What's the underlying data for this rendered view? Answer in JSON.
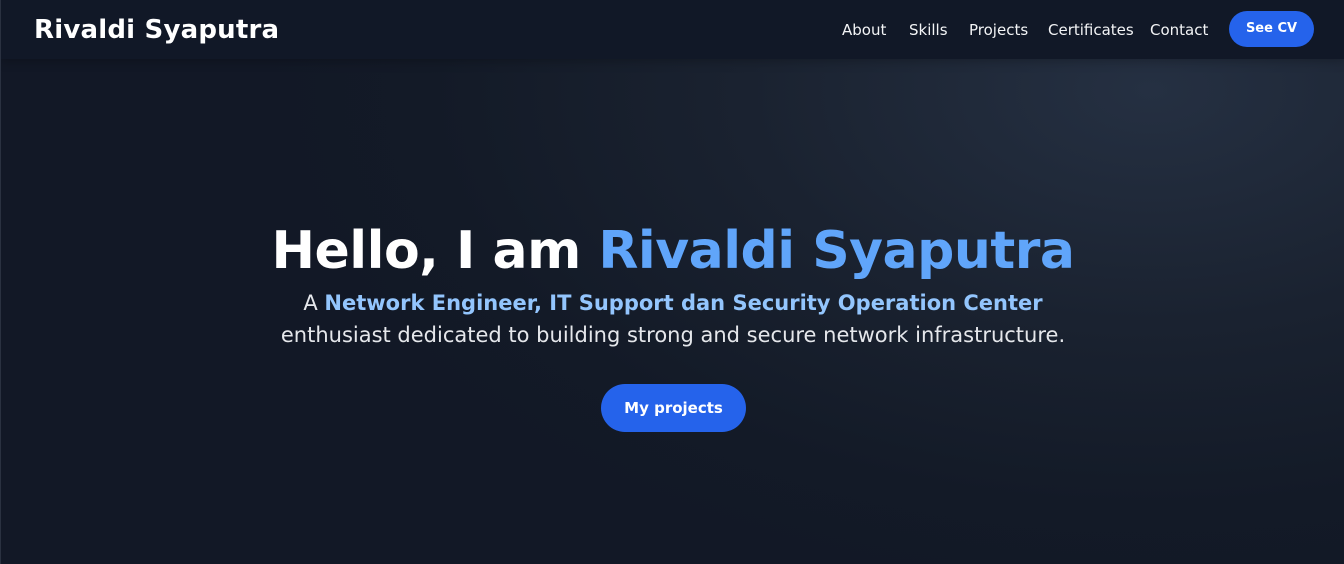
{
  "nav": {
    "brand": "Rivaldi Syaputra",
    "links": [
      "About",
      "Skills",
      "Projects",
      "Certificates",
      "Contact"
    ],
    "cta_label": "See CV"
  },
  "hero": {
    "greeting": "Hello, I am",
    "name": "Rivaldi Syaputra",
    "intro_prefix": "A",
    "roles": "Network Engineer, IT Support dan Security Operation Center",
    "description": "enthusiast dedicated to building strong and secure network infrastructure.",
    "button_label": "My projects"
  },
  "colors": {
    "background": "#111827",
    "accent": "#60a5fa",
    "accent_light": "#93c5fd",
    "button": "#2563eb",
    "text": "#ffffff"
  }
}
